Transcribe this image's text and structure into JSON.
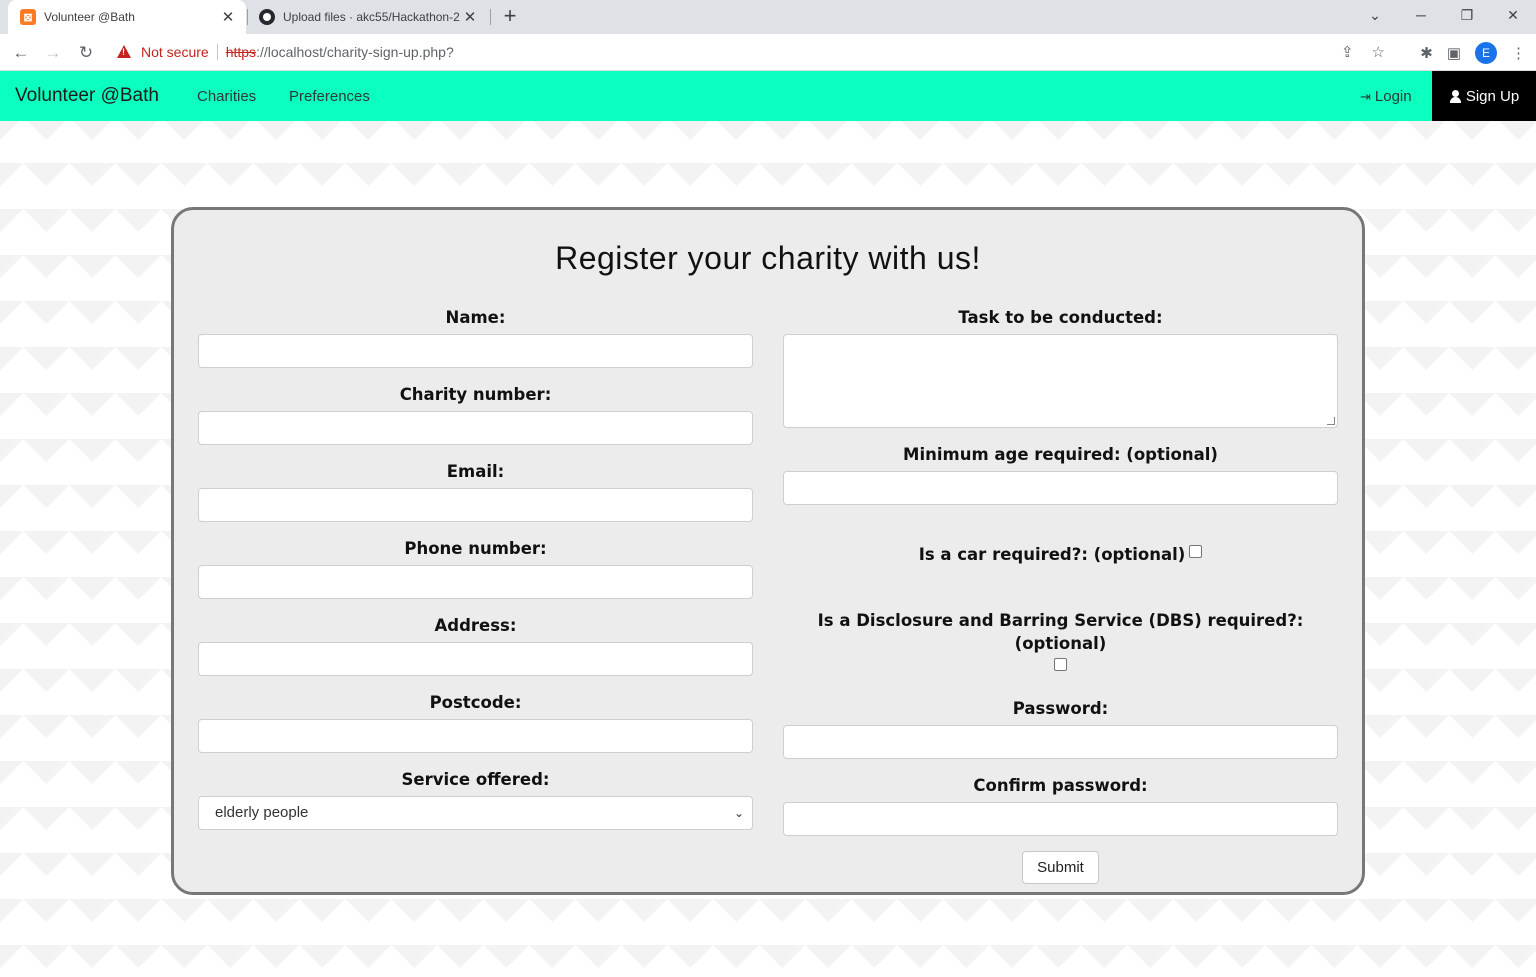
{
  "browser": {
    "tabs": [
      {
        "title": "Volunteer @Bath",
        "active": true,
        "favicon": "xampp-icon"
      },
      {
        "title": "Upload files · akc55/Hackathon-2",
        "active": false,
        "favicon": "github-icon"
      }
    ],
    "security_label": "Not secure",
    "url_scheme": "https",
    "url_rest": "://localhost/charity-sign-up.php?",
    "profile_initial": "E"
  },
  "navbar": {
    "brand": "Volunteer @Bath",
    "links": [
      "Charities",
      "Preferences"
    ],
    "login": "Login",
    "signup": "Sign Up",
    "bg_color": "#0bffbf"
  },
  "form": {
    "title": "Register your charity with us!",
    "left": {
      "name_label": "Name:",
      "charity_number_label": "Charity number:",
      "email_label": "Email:",
      "phone_label": "Phone number:",
      "address_label": "Address:",
      "postcode_label": "Postcode:",
      "service_label": "Service offered:",
      "service_value": "elderly people"
    },
    "right": {
      "task_label": "Task to be conducted:",
      "min_age_label": "Minimum age required: (optional)",
      "car_label": "Is a car required?: (optional)",
      "dbs_label_line1": "Is a Disclosure and Barring Service (DBS) required?:",
      "dbs_label_line2": "(optional)",
      "password_label": "Password:",
      "confirm_password_label": "Confirm password:"
    },
    "submit": "Submit"
  }
}
